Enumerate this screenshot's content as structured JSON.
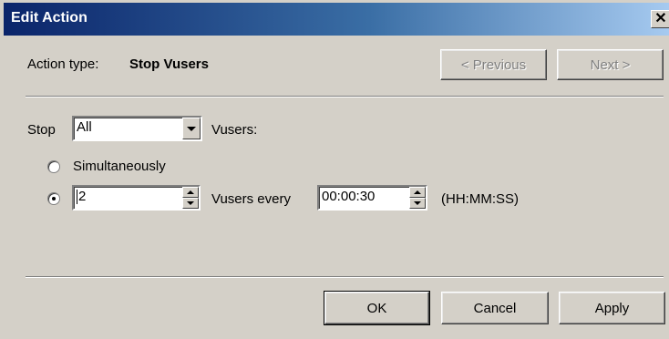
{
  "window": {
    "title": "Edit Action"
  },
  "header": {
    "action_type_label": "Action type:",
    "action_type_value": "Stop Vusers",
    "previous_label": "< Previous",
    "next_label": "Next >"
  },
  "stop_row": {
    "stop_label": "Stop",
    "selected_option": "All",
    "vusers_label": "Vusers:"
  },
  "mode": {
    "simultaneously_label": "Simultaneously",
    "simultaneously_selected": false,
    "gradual_selected": true,
    "vuser_count": "2",
    "vusers_every_label": "Vusers every",
    "interval": "00:00:30",
    "format_hint": "(HH:MM:SS)"
  },
  "footer": {
    "ok_label": "OK",
    "cancel_label": "Cancel",
    "apply_label": "Apply"
  },
  "colors": {
    "title_start": "#0a246a",
    "title_end": "#a6caf0",
    "face": "#d4d0c8"
  }
}
